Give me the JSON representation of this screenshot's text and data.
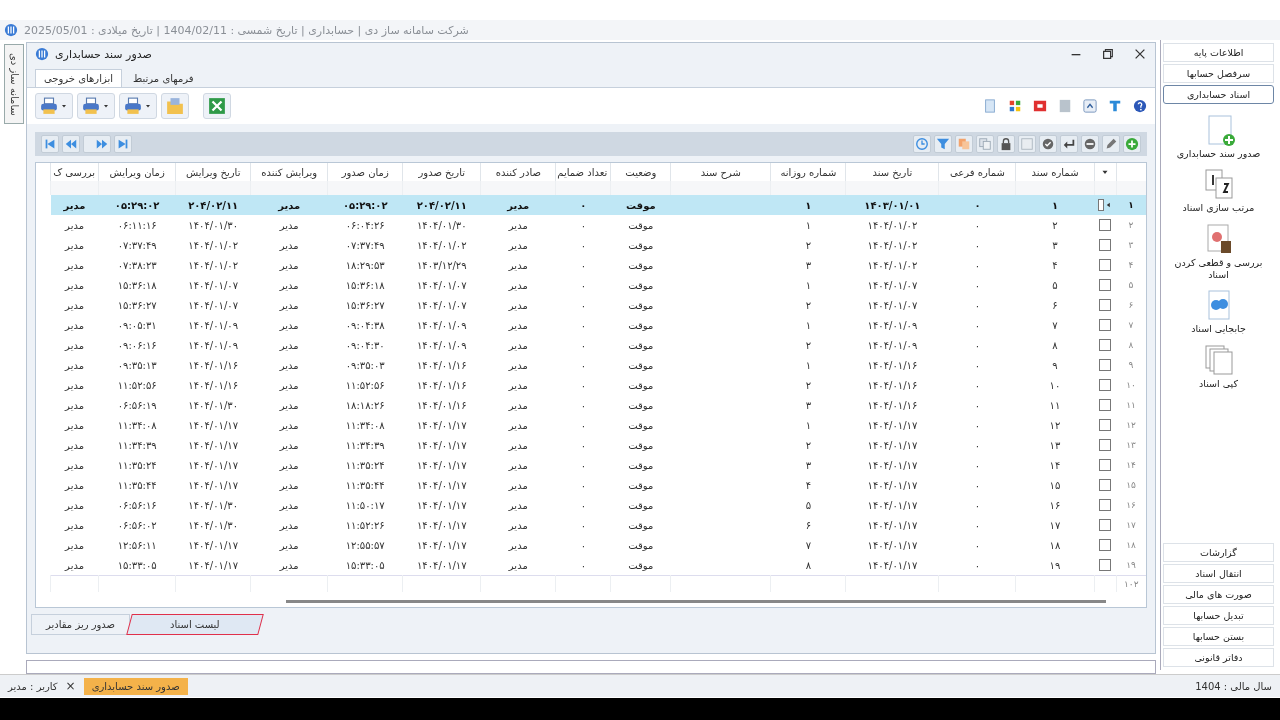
{
  "app_title": "شرکت سامانه ساز دی | حسابداری | تاریخ شمسی : 1404/02/11 | تاریخ میلادی : 2025/05/01",
  "side_tab": "سامانه ساز دی",
  "window": {
    "title": "صدور سند حسابداری"
  },
  "ribbon": {
    "tabs": [
      {
        "label": "فرمهای مرتبط",
        "selected": false
      },
      {
        "label": "ابزارهای خروجی",
        "selected": true
      }
    ]
  },
  "table": {
    "columns": [
      {
        "label": "شماره سند",
        "kind": "text"
      },
      {
        "label": "شماره فرعی",
        "kind": "text"
      },
      {
        "label": "تاریخ سند",
        "kind": "text"
      },
      {
        "label": "شماره روزانه",
        "kind": "text"
      },
      {
        "label": "شرح سند",
        "kind": "text"
      },
      {
        "label": "وضعیت",
        "kind": "text"
      },
      {
        "label": "تعداد ضمایم",
        "kind": "text"
      },
      {
        "label": "صادر کننده",
        "kind": "text"
      },
      {
        "label": "تاریخ صدور",
        "kind": "text"
      },
      {
        "label": "زمان صدور",
        "kind": "text"
      },
      {
        "label": "ویرایش کننده",
        "kind": "text"
      },
      {
        "label": "تاریخ ویرایش",
        "kind": "text"
      },
      {
        "label": "زمان ویرایش",
        "kind": "text"
      },
      {
        "label": "بررسی ک",
        "kind": "text"
      }
    ],
    "rows": [
      {
        "number": "۱",
        "selected": true,
        "checked": false,
        "cells": [
          "۱",
          "۰",
          "۱۴۰۳/۰۱/۰۱",
          "۱",
          "",
          "موقت",
          "۰",
          "مدیر",
          "۲۰۴/۰۲/۱۱",
          "۰۵:۲۹:۰۲",
          "مدیر",
          "۲۰۴/۰۲/۱۱",
          "۰۵:۲۹:۰۲",
          "مدیر"
        ]
      },
      {
        "number": "۲",
        "selected": false,
        "checked": false,
        "cells": [
          "۲",
          "۰",
          "۱۴۰۴/۰۱/۰۲",
          "۱",
          "",
          "موقت",
          "۰",
          "مدیر",
          "۱۴۰۴/۰۱/۳۰",
          "۰۶:۰۴:۲۶",
          "مدیر",
          "۱۴۰۴/۰۱/۳۰",
          "۰۶:۱۱:۱۶",
          "مدیر"
        ]
      },
      {
        "number": "۳",
        "selected": false,
        "checked": false,
        "cells": [
          "۳",
          "۰",
          "۱۴۰۴/۰۱/۰۲",
          "۲",
          "",
          "موقت",
          "۰",
          "مدیر",
          "۱۴۰۴/۰۱/۰۲",
          "۰۷:۳۷:۴۹",
          "مدیر",
          "۱۴۰۴/۰۱/۰۲",
          "۰۷:۳۷:۴۹",
          "مدیر"
        ]
      },
      {
        "number": "۴",
        "selected": false,
        "checked": false,
        "cells": [
          "۴",
          "۰",
          "۱۴۰۴/۰۱/۰۲",
          "۳",
          "",
          "موقت",
          "۰",
          "مدیر",
          "۱۴۰۳/۱۲/۲۹",
          "۱۸:۲۹:۵۳",
          "مدیر",
          "۱۴۰۴/۰۱/۰۲",
          "۰۷:۳۸:۲۳",
          "مدیر"
        ]
      },
      {
        "number": "۵",
        "selected": false,
        "checked": false,
        "cells": [
          "۵",
          "۰",
          "۱۴۰۴/۰۱/۰۷",
          "۱",
          "",
          "موقت",
          "۰",
          "مدیر",
          "۱۴۰۴/۰۱/۰۷",
          "۱۵:۳۶:۱۸",
          "مدیر",
          "۱۴۰۴/۰۱/۰۷",
          "۱۵:۳۶:۱۸",
          "مدیر"
        ]
      },
      {
        "number": "۶",
        "selected": false,
        "checked": false,
        "cells": [
          "۶",
          "۰",
          "۱۴۰۴/۰۱/۰۷",
          "۲",
          "",
          "موقت",
          "۰",
          "مدیر",
          "۱۴۰۴/۰۱/۰۷",
          "۱۵:۳۶:۲۷",
          "مدیر",
          "۱۴۰۴/۰۱/۰۷",
          "۱۵:۳۶:۲۷",
          "مدیر"
        ]
      },
      {
        "number": "۷",
        "selected": false,
        "checked": false,
        "cells": [
          "۷",
          "۰",
          "۱۴۰۴/۰۱/۰۹",
          "۱",
          "",
          "موقت",
          "۰",
          "مدیر",
          "۱۴۰۴/۰۱/۰۹",
          "۰۹:۰۴:۳۸",
          "مدیر",
          "۱۴۰۴/۰۱/۰۹",
          "۰۹:۰۵:۳۱",
          "مدیر"
        ]
      },
      {
        "number": "۸",
        "selected": false,
        "checked": false,
        "cells": [
          "۸",
          "۰",
          "۱۴۰۴/۰۱/۰۹",
          "۲",
          "",
          "موقت",
          "۰",
          "مدیر",
          "۱۴۰۴/۰۱/۰۹",
          "۰۹:۰۴:۳۰",
          "مدیر",
          "۱۴۰۴/۰۱/۰۹",
          "۰۹:۰۶:۱۶",
          "مدیر"
        ]
      },
      {
        "number": "۹",
        "selected": false,
        "checked": false,
        "cells": [
          "۹",
          "۰",
          "۱۴۰۴/۰۱/۱۶",
          "۱",
          "",
          "موقت",
          "۰",
          "مدیر",
          "۱۴۰۴/۰۱/۱۶",
          "۰۹:۳۵:۰۳",
          "مدیر",
          "۱۴۰۴/۰۱/۱۶",
          "۰۹:۳۵:۱۳",
          "مدیر"
        ]
      },
      {
        "number": "۱۰",
        "selected": false,
        "checked": false,
        "cells": [
          "۱۰",
          "۰",
          "۱۴۰۴/۰۱/۱۶",
          "۲",
          "",
          "موقت",
          "۰",
          "مدیر",
          "۱۴۰۴/۰۱/۱۶",
          "۱۱:۵۲:۵۶",
          "مدیر",
          "۱۴۰۴/۰۱/۱۶",
          "۱۱:۵۲:۵۶",
          "مدیر"
        ]
      },
      {
        "number": "۱۱",
        "selected": false,
        "checked": false,
        "cells": [
          "۱۱",
          "۰",
          "۱۴۰۴/۰۱/۱۶",
          "۳",
          "",
          "موقت",
          "۰",
          "مدیر",
          "۱۴۰۴/۰۱/۱۶",
          "۱۸:۱۸:۲۶",
          "مدیر",
          "۱۴۰۴/۰۱/۳۰",
          "۰۶:۵۶:۱۹",
          "مدیر"
        ]
      },
      {
        "number": "۱۲",
        "selected": false,
        "checked": false,
        "cells": [
          "۱۲",
          "۰",
          "۱۴۰۴/۰۱/۱۷",
          "۱",
          "",
          "موقت",
          "۰",
          "مدیر",
          "۱۴۰۴/۰۱/۱۷",
          "۱۱:۳۴:۰۸",
          "مدیر",
          "۱۴۰۴/۰۱/۱۷",
          "۱۱:۳۴:۰۸",
          "مدیر"
        ]
      },
      {
        "number": "۱۳",
        "selected": false,
        "checked": false,
        "cells": [
          "۱۳",
          "۰",
          "۱۴۰۴/۰۱/۱۷",
          "۲",
          "",
          "موقت",
          "۰",
          "مدیر",
          "۱۴۰۴/۰۱/۱۷",
          "۱۱:۳۴:۳۹",
          "مدیر",
          "۱۴۰۴/۰۱/۱۷",
          "۱۱:۳۴:۳۹",
          "مدیر"
        ]
      },
      {
        "number": "۱۴",
        "selected": false,
        "checked": false,
        "cells": [
          "۱۴",
          "۰",
          "۱۴۰۴/۰۱/۱۷",
          "۳",
          "",
          "موقت",
          "۰",
          "مدیر",
          "۱۴۰۴/۰۱/۱۷",
          "۱۱:۳۵:۲۴",
          "مدیر",
          "۱۴۰۴/۰۱/۱۷",
          "۱۱:۳۵:۲۴",
          "مدیر"
        ]
      },
      {
        "number": "۱۵",
        "selected": false,
        "checked": false,
        "cells": [
          "۱۵",
          "۰",
          "۱۴۰۴/۰۱/۱۷",
          "۴",
          "",
          "موقت",
          "۰",
          "مدیر",
          "۱۴۰۴/۰۱/۱۷",
          "۱۱:۳۵:۴۴",
          "مدیر",
          "۱۴۰۴/۰۱/۱۷",
          "۱۱:۳۵:۴۴",
          "مدیر"
        ]
      },
      {
        "number": "۱۶",
        "selected": false,
        "checked": false,
        "cells": [
          "۱۶",
          "۰",
          "۱۴۰۴/۰۱/۱۷",
          "۵",
          "",
          "موقت",
          "۰",
          "مدیر",
          "۱۴۰۴/۰۱/۱۷",
          "۱۱:۵۰:۱۷",
          "مدیر",
          "۱۴۰۴/۰۱/۳۰",
          "۰۶:۵۶:۱۶",
          "مدیر"
        ]
      },
      {
        "number": "۱۷",
        "selected": false,
        "checked": false,
        "cells": [
          "۱۷",
          "۰",
          "۱۴۰۴/۰۱/۱۷",
          "۶",
          "",
          "موقت",
          "۰",
          "مدیر",
          "۱۴۰۴/۰۱/۱۷",
          "۱۱:۵۲:۲۶",
          "مدیر",
          "۱۴۰۴/۰۱/۳۰",
          "۰۶:۵۶:۰۲",
          "مدیر"
        ]
      },
      {
        "number": "۱۸",
        "selected": false,
        "checked": false,
        "cells": [
          "۱۸",
          "۰",
          "۱۴۰۴/۰۱/۱۷",
          "۷",
          "",
          "موقت",
          "۰",
          "مدیر",
          "۱۴۰۴/۰۱/۱۷",
          "۱۲:۵۵:۵۷",
          "مدیر",
          "۱۴۰۴/۰۱/۱۷",
          "۱۲:۵۶:۱۱",
          "مدیر"
        ]
      },
      {
        "number": "۱۹",
        "selected": false,
        "checked": false,
        "cells": [
          "۱۹",
          "۰",
          "۱۴۰۴/۰۱/۱۷",
          "۸",
          "",
          "موقت",
          "۰",
          "مدیر",
          "۱۴۰۴/۰۱/۱۷",
          "۱۵:۳۳:۰۵",
          "مدیر",
          "۱۴۰۴/۰۱/۱۷",
          "۱۵:۳۳:۰۵",
          "مدیر"
        ]
      }
    ],
    "footer_count": "۱۰۲"
  },
  "bottom_tabs": [
    {
      "label": "لیست اسناد",
      "selected": true
    },
    {
      "label": "صدور ریز مقادیر",
      "selected": false
    }
  ],
  "sidebar": {
    "sections": [
      {
        "label": "اطلاعات پایه",
        "selected": false
      },
      {
        "label": "سرفصل حسابها",
        "selected": false
      },
      {
        "label": "اسناد حسابداری",
        "selected": true
      }
    ],
    "items": [
      {
        "label": "صدور سند حسابداری",
        "kind": "new"
      },
      {
        "label": "مرتب سازی اسناد",
        "kind": "sort"
      },
      {
        "label": "بررسی و قطعی کردن اسناد",
        "kind": "review"
      },
      {
        "label": "جابجایی اسناد",
        "kind": "move"
      },
      {
        "label": "کپی اسناد",
        "kind": "copy"
      }
    ],
    "links": [
      "گزارشات",
      "انتقال اسناد",
      "صورت های مالی",
      "تبدیل حسابها",
      "بستن حسابها",
      "دفاتر قانونی"
    ]
  },
  "taskbar": {
    "user": "کاربر : مدیر",
    "close": "×",
    "task": "صدور سند حسابداری",
    "fiscal_year": "سال مالی : 1404"
  }
}
